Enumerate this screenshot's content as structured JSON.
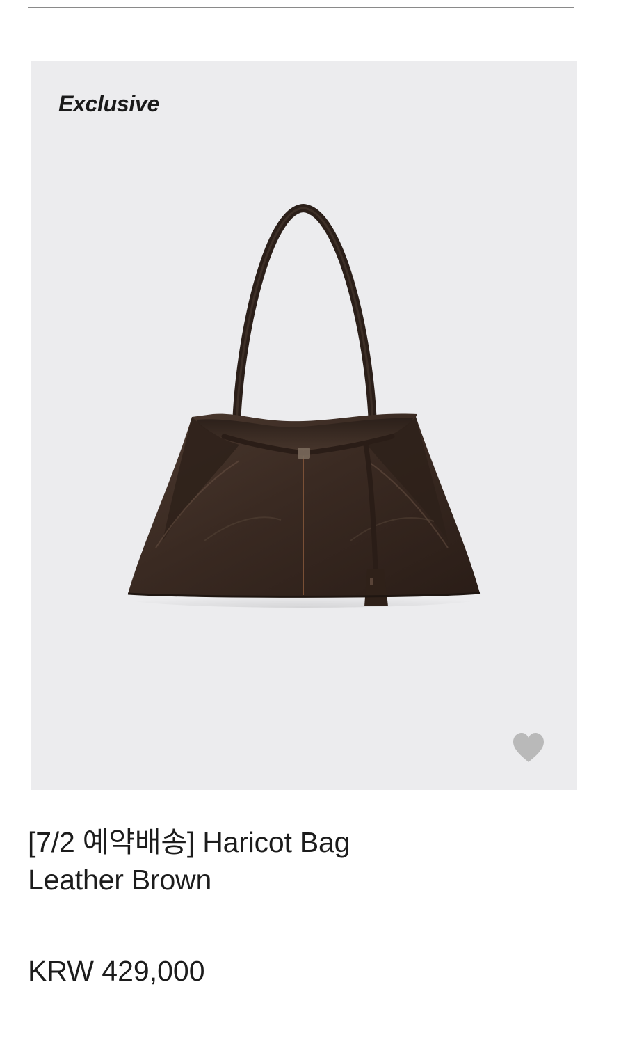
{
  "product": {
    "badge": "Exclusive",
    "name_line1": "[7/2 예약배송] Haricot Bag",
    "name_line2": "Leather Brown",
    "price": "KRW 429,000",
    "wishlist_icon": "heart-icon",
    "image_subject": "bag-image"
  },
  "colors": {
    "image_background": "#ececee",
    "leather": "#3a2a22",
    "heart": "#b9b9b9"
  }
}
